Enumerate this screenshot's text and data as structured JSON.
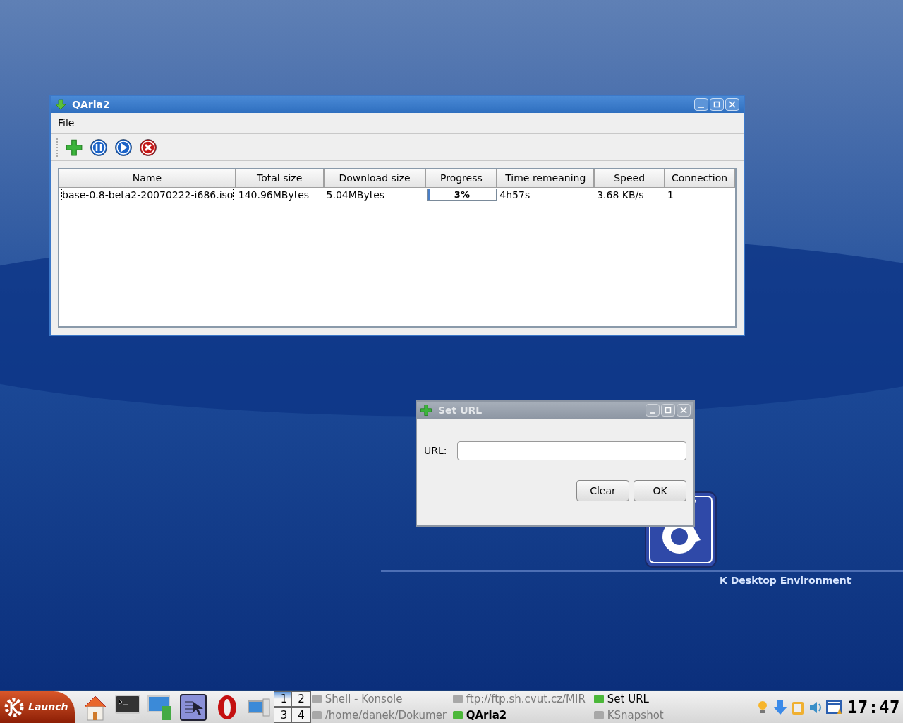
{
  "main_window": {
    "title": "QAria2",
    "active": true,
    "menu": [
      "File"
    ],
    "table": {
      "columns": [
        "Name",
        "Total size",
        "Download size",
        "Progress",
        "Time remeaning",
        "Speed",
        "Connection"
      ],
      "rows": [
        {
          "name": "base-0.8-beta2-20070222-i686.iso",
          "total_size": "140.96MBytes",
          "download_size": "5.04MBytes",
          "progress": {
            "level": 0.03,
            "label": "3%"
          },
          "time_remaining": "4h57s",
          "speed": "3.68 KB/s",
          "connection": "1",
          "selected": true
        }
      ]
    }
  },
  "dialog": {
    "title": "Set URL",
    "active": false,
    "field_label": "URL:",
    "buttons": [
      "Clear",
      "OK"
    ]
  },
  "desktop": {
    "logo_caption": "K Desktop Environment"
  },
  "taskbar": {
    "launch_label": "Launch",
    "pager": [
      {
        "label": "1",
        "selected": true
      },
      {
        "label": "2",
        "selected": false
      },
      {
        "label": "3",
        "selected": false
      },
      {
        "label": "4",
        "selected": false
      }
    ],
    "tasks": [
      {
        "label": "Shell - Konsole",
        "selected": false,
        "dimmed": true
      },
      {
        "label": "ftp://ftp.sh.cvut.cz/MIR",
        "selected": false,
        "dimmed": true
      },
      {
        "label": "Set URL",
        "selected": false,
        "dimmed": false
      },
      {
        "label": "/home/danek/Dokumer",
        "selected": false,
        "dimmed": true
      },
      {
        "label": "QAria2",
        "selected": true,
        "dimmed": false
      },
      {
        "label": "KSnapshot",
        "selected": false,
        "dimmed": true
      }
    ],
    "clock": "17:47"
  }
}
